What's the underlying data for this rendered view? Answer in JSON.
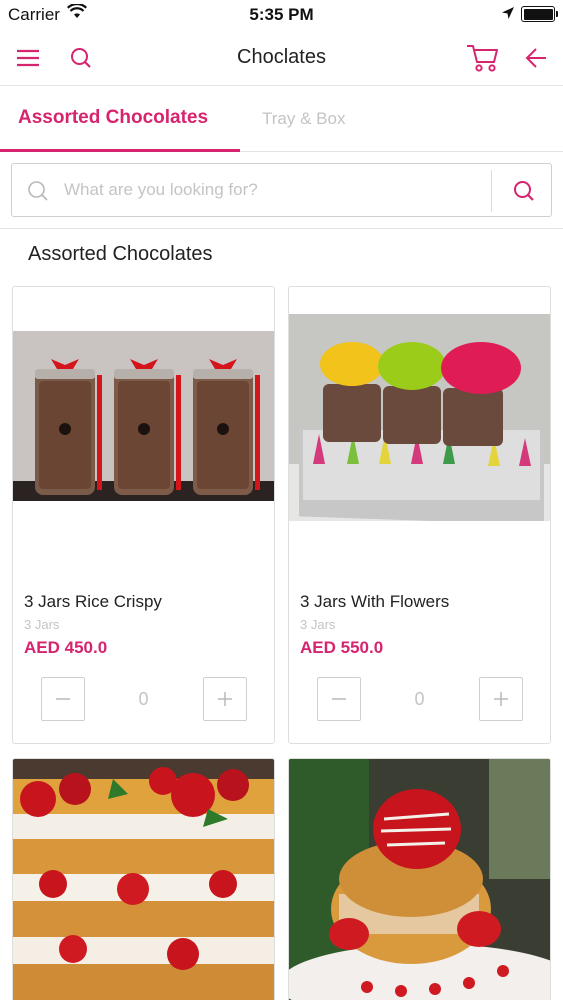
{
  "status_bar": {
    "carrier": "Carrier",
    "time": "5:35 PM"
  },
  "nav": {
    "title": "Choclates"
  },
  "tabs": [
    {
      "label": "Assorted Chocolates",
      "active": true
    },
    {
      "label": "Tray & Box",
      "active": false
    }
  ],
  "search": {
    "placeholder": "What are you looking for?",
    "value": ""
  },
  "section": {
    "title": "Assorted Chocolates"
  },
  "products": [
    {
      "name": "3 Jars Rice Crispy",
      "subtitle": "3 Jars",
      "price": "AED  450.0",
      "quantity": "0"
    },
    {
      "name": "3 Jars With Flowers",
      "subtitle": "3 Jars",
      "price": "AED  550.0",
      "quantity": "0"
    }
  ],
  "colors": {
    "accent": "#d6246e",
    "muted": "#c4c4c4",
    "border": "#dedede"
  },
  "icons": [
    "wifi-icon",
    "location-arrow-icon",
    "battery-icon",
    "menu-icon",
    "search-icon",
    "cart-icon",
    "back-arrow-icon",
    "minus-icon",
    "plus-icon"
  ]
}
